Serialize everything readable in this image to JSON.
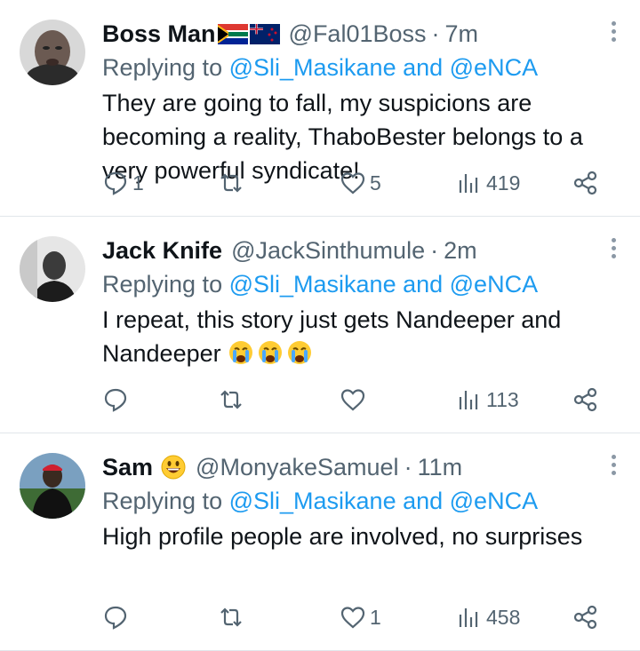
{
  "tweets": [
    {
      "name": "Boss Man",
      "handle": "@Fal01Boss",
      "sep": "·",
      "time": "7m",
      "replying_prefix": "Replying to",
      "replying_to": "@Sli_Masikane and @eNCA",
      "body": "They are going to fall, my suspicions are becoming a reality, ThaboBester belongs to a very powerful syndicate!",
      "replies": "1",
      "retweets": "",
      "likes": "5",
      "views": "419"
    },
    {
      "name": "Jack Knife",
      "handle": "@JackSinthumule",
      "sep": "·",
      "time": "2m",
      "replying_prefix": "Replying to",
      "replying_to": "@Sli_Masikane and @eNCA",
      "body": "I repeat, this story just gets Nandeeper and Nandeeper",
      "replies": "",
      "retweets": "",
      "likes": "",
      "views": "113"
    },
    {
      "name": "Sam",
      "handle": "@MonyakeSamuel",
      "sep": "·",
      "time": "11m",
      "replying_prefix": "Replying to",
      "replying_to": "@Sli_Masikane and @eNCA",
      "body": "High profile people are involved, no surprises",
      "replies": "",
      "retweets": "",
      "likes": "1",
      "views": "458"
    }
  ],
  "colors": {
    "link": "#1d9bf0",
    "muted": "#536471",
    "text": "#0f1419"
  },
  "icons": [
    "reply-icon",
    "retweet-icon",
    "like-icon",
    "views-icon",
    "share-icon",
    "more-icon",
    "avatar",
    "south-africa-flag-icon",
    "new-zealand-flag-icon",
    "crying-emoji-icon",
    "grinning-emoji-icon"
  ]
}
